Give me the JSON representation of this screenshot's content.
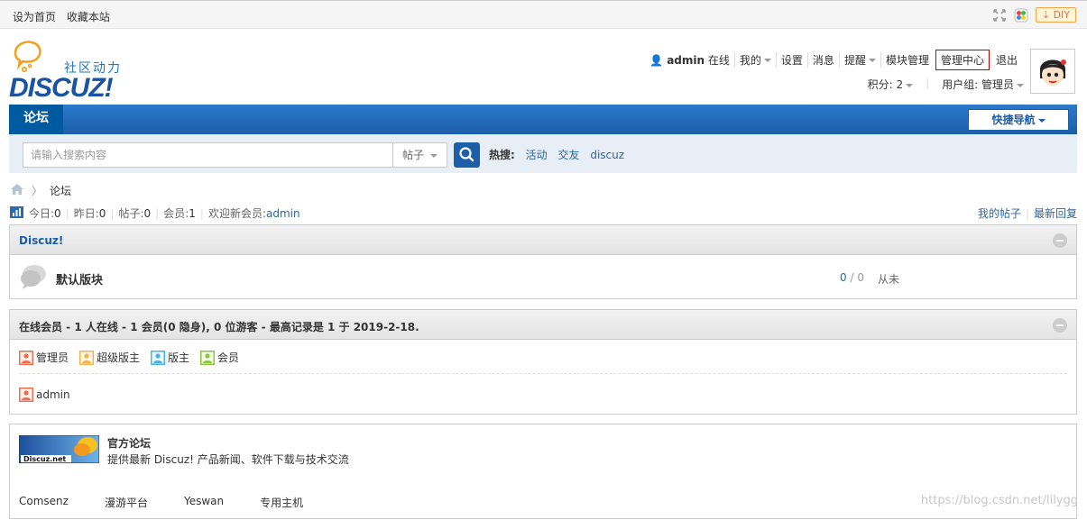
{
  "topbar": {
    "set_home": "设为首页",
    "bookmark": "收藏本站",
    "diy": "DIY"
  },
  "logo": {
    "slogan": "社区动力",
    "brand": "DISCUZ!"
  },
  "usermenu": {
    "username": "admin",
    "status": "在线",
    "items": [
      "我的",
      "设置",
      "消息",
      "提醒",
      "模块管理",
      "管理中心",
      "退出"
    ]
  },
  "userinfo": {
    "credits": "积分: 2",
    "group": "用户组: 管理员"
  },
  "nav": {
    "forum_tab": "论坛",
    "quick_nav": "快捷导航"
  },
  "search": {
    "placeholder": "请输入搜索内容",
    "scope": "帖子",
    "hot_label": "热搜:",
    "hot_terms": [
      "活动",
      "交友",
      "discuz"
    ]
  },
  "breadcrumb": {
    "current": "论坛"
  },
  "stats": {
    "today_label": "今日:",
    "today": "0",
    "yesterday_label": "昨日:",
    "yesterday": "0",
    "posts_label": "帖子:",
    "posts": "0",
    "members_label": "会员:",
    "members": "1",
    "welcome_label": "欢迎新会员:",
    "newest_member": "admin",
    "my_posts": "我的帖子",
    "latest_replies": "最新回复"
  },
  "category": {
    "title": "Discuz!",
    "forum_name": "默认版块",
    "threads": "0",
    "posts": "0",
    "last_post": "从未"
  },
  "online": {
    "title": "在线会员 - 1 人在线 - 1 会员(0 隐身), 0 位游客 - 最高记录是 1 于 2019-2-18.",
    "legend": [
      "管理员",
      "超级版主",
      "版主",
      "会员"
    ],
    "users": [
      "admin"
    ]
  },
  "friendlinks": {
    "logo_text": "Discuz.net",
    "title": "官方论坛",
    "desc": "提供最新 Discuz! 产品新闻、软件下载与技术交流",
    "links": [
      "Comsenz",
      "漫游平台",
      "Yeswan",
      "专用主机"
    ]
  },
  "watermark": "https://blog.csdn.net/lilygg",
  "colors": {
    "nav_blue": "#1c5ea8",
    "link_blue": "#336699",
    "admin_orange": "#f26c4f"
  }
}
